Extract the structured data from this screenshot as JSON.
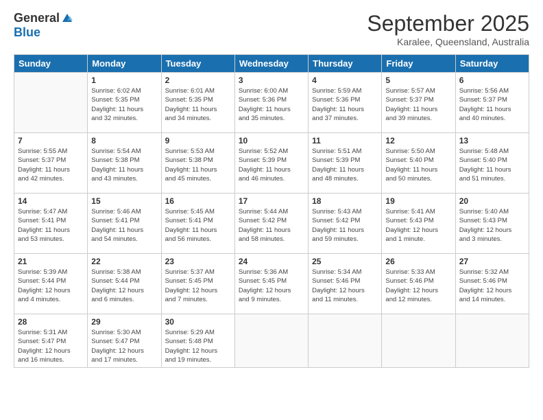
{
  "logo": {
    "general": "General",
    "blue": "Blue"
  },
  "title": "September 2025",
  "subtitle": "Karalee, Queensland, Australia",
  "headers": [
    "Sunday",
    "Monday",
    "Tuesday",
    "Wednesday",
    "Thursday",
    "Friday",
    "Saturday"
  ],
  "weeks": [
    [
      {
        "day": "",
        "text": ""
      },
      {
        "day": "1",
        "text": "Sunrise: 6:02 AM\nSunset: 5:35 PM\nDaylight: 11 hours\nand 32 minutes."
      },
      {
        "day": "2",
        "text": "Sunrise: 6:01 AM\nSunset: 5:35 PM\nDaylight: 11 hours\nand 34 minutes."
      },
      {
        "day": "3",
        "text": "Sunrise: 6:00 AM\nSunset: 5:36 PM\nDaylight: 11 hours\nand 35 minutes."
      },
      {
        "day": "4",
        "text": "Sunrise: 5:59 AM\nSunset: 5:36 PM\nDaylight: 11 hours\nand 37 minutes."
      },
      {
        "day": "5",
        "text": "Sunrise: 5:57 AM\nSunset: 5:37 PM\nDaylight: 11 hours\nand 39 minutes."
      },
      {
        "day": "6",
        "text": "Sunrise: 5:56 AM\nSunset: 5:37 PM\nDaylight: 11 hours\nand 40 minutes."
      }
    ],
    [
      {
        "day": "7",
        "text": "Sunrise: 5:55 AM\nSunset: 5:37 PM\nDaylight: 11 hours\nand 42 minutes."
      },
      {
        "day": "8",
        "text": "Sunrise: 5:54 AM\nSunset: 5:38 PM\nDaylight: 11 hours\nand 43 minutes."
      },
      {
        "day": "9",
        "text": "Sunrise: 5:53 AM\nSunset: 5:38 PM\nDaylight: 11 hours\nand 45 minutes."
      },
      {
        "day": "10",
        "text": "Sunrise: 5:52 AM\nSunset: 5:39 PM\nDaylight: 11 hours\nand 46 minutes."
      },
      {
        "day": "11",
        "text": "Sunrise: 5:51 AM\nSunset: 5:39 PM\nDaylight: 11 hours\nand 48 minutes."
      },
      {
        "day": "12",
        "text": "Sunrise: 5:50 AM\nSunset: 5:40 PM\nDaylight: 11 hours\nand 50 minutes."
      },
      {
        "day": "13",
        "text": "Sunrise: 5:48 AM\nSunset: 5:40 PM\nDaylight: 11 hours\nand 51 minutes."
      }
    ],
    [
      {
        "day": "14",
        "text": "Sunrise: 5:47 AM\nSunset: 5:41 PM\nDaylight: 11 hours\nand 53 minutes."
      },
      {
        "day": "15",
        "text": "Sunrise: 5:46 AM\nSunset: 5:41 PM\nDaylight: 11 hours\nand 54 minutes."
      },
      {
        "day": "16",
        "text": "Sunrise: 5:45 AM\nSunset: 5:41 PM\nDaylight: 11 hours\nand 56 minutes."
      },
      {
        "day": "17",
        "text": "Sunrise: 5:44 AM\nSunset: 5:42 PM\nDaylight: 11 hours\nand 58 minutes."
      },
      {
        "day": "18",
        "text": "Sunrise: 5:43 AM\nSunset: 5:42 PM\nDaylight: 11 hours\nand 59 minutes."
      },
      {
        "day": "19",
        "text": "Sunrise: 5:41 AM\nSunset: 5:43 PM\nDaylight: 12 hours\nand 1 minute."
      },
      {
        "day": "20",
        "text": "Sunrise: 5:40 AM\nSunset: 5:43 PM\nDaylight: 12 hours\nand 3 minutes."
      }
    ],
    [
      {
        "day": "21",
        "text": "Sunrise: 5:39 AM\nSunset: 5:44 PM\nDaylight: 12 hours\nand 4 minutes."
      },
      {
        "day": "22",
        "text": "Sunrise: 5:38 AM\nSunset: 5:44 PM\nDaylight: 12 hours\nand 6 minutes."
      },
      {
        "day": "23",
        "text": "Sunrise: 5:37 AM\nSunset: 5:45 PM\nDaylight: 12 hours\nand 7 minutes."
      },
      {
        "day": "24",
        "text": "Sunrise: 5:36 AM\nSunset: 5:45 PM\nDaylight: 12 hours\nand 9 minutes."
      },
      {
        "day": "25",
        "text": "Sunrise: 5:34 AM\nSunset: 5:46 PM\nDaylight: 12 hours\nand 11 minutes."
      },
      {
        "day": "26",
        "text": "Sunrise: 5:33 AM\nSunset: 5:46 PM\nDaylight: 12 hours\nand 12 minutes."
      },
      {
        "day": "27",
        "text": "Sunrise: 5:32 AM\nSunset: 5:46 PM\nDaylight: 12 hours\nand 14 minutes."
      }
    ],
    [
      {
        "day": "28",
        "text": "Sunrise: 5:31 AM\nSunset: 5:47 PM\nDaylight: 12 hours\nand 16 minutes."
      },
      {
        "day": "29",
        "text": "Sunrise: 5:30 AM\nSunset: 5:47 PM\nDaylight: 12 hours\nand 17 minutes."
      },
      {
        "day": "30",
        "text": "Sunrise: 5:29 AM\nSunset: 5:48 PM\nDaylight: 12 hours\nand 19 minutes."
      },
      {
        "day": "",
        "text": ""
      },
      {
        "day": "",
        "text": ""
      },
      {
        "day": "",
        "text": ""
      },
      {
        "day": "",
        "text": ""
      }
    ]
  ]
}
